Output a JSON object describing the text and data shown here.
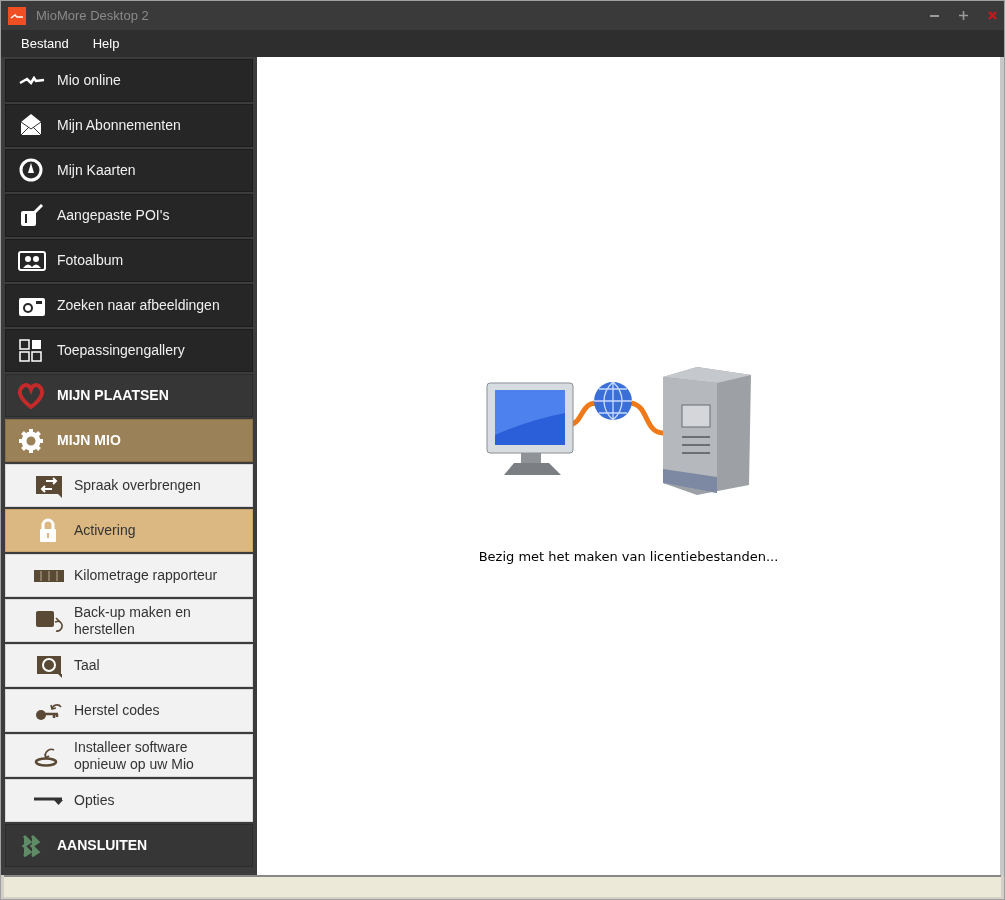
{
  "window": {
    "title": "MioMore Desktop 2"
  },
  "menu": [
    "Bestand",
    "Help"
  ],
  "sidebar": {
    "items": [
      {
        "kind": "top",
        "label": "Mio online"
      },
      {
        "kind": "top",
        "label": "Mijn Abonnementen"
      },
      {
        "kind": "top",
        "label": "Mijn Kaarten"
      },
      {
        "kind": "top",
        "label": "Aangepaste POI's"
      },
      {
        "kind": "top",
        "label": "Fotoalbum"
      },
      {
        "kind": "top",
        "label": "Zoeken naar afbeeldingen"
      },
      {
        "kind": "top",
        "label": "Toepassingengallery"
      },
      {
        "kind": "section",
        "label": "MIJN PLAATSEN",
        "expanded": false
      },
      {
        "kind": "section",
        "label": "MIJN MIO",
        "expanded": true
      },
      {
        "kind": "sub",
        "label": "Spraak overbrengen",
        "selected": false
      },
      {
        "kind": "sub",
        "label": "Activering",
        "selected": true
      },
      {
        "kind": "sub",
        "label": "Kilometrage rapporteur",
        "selected": false
      },
      {
        "kind": "sub",
        "label": "Back-up maken en herstellen",
        "selected": false
      },
      {
        "kind": "sub",
        "label": "Taal",
        "selected": false
      },
      {
        "kind": "sub",
        "label": "Herstel codes",
        "selected": false
      },
      {
        "kind": "sub",
        "label": "Installeer software opnieuw op uw Mio",
        "selected": false
      },
      {
        "kind": "sub",
        "label": "Opties",
        "selected": false
      },
      {
        "kind": "section",
        "label": "AANSLUITEN",
        "expanded": false
      }
    ]
  },
  "content": {
    "message": "Bezig met het maken van licentiebestanden..."
  }
}
